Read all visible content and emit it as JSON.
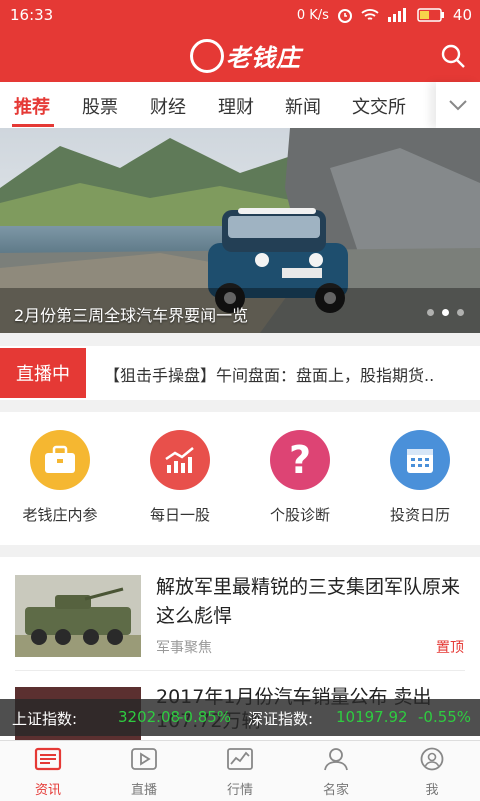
{
  "status": {
    "time": "16:33",
    "net_speed": "0 K/s",
    "battery": "40"
  },
  "header": {
    "brand": "老钱庄",
    "search_icon": "search-icon"
  },
  "tabs": [
    {
      "label": "推荐",
      "active": true
    },
    {
      "label": "股票"
    },
    {
      "label": "财经"
    },
    {
      "label": "理财"
    },
    {
      "label": "新闻"
    },
    {
      "label": "文交所"
    }
  ],
  "banner": {
    "caption": "2月份第三周全球汽车界要闻一览",
    "slide_index": 2,
    "slide_count": 3
  },
  "live": {
    "badge": "直播中",
    "text": "【狙击手操盘】午间盘面：盘面上，股指期货.."
  },
  "grid": [
    {
      "label": "老钱庄内参",
      "icon": "briefcase-icon",
      "color": "#f5b731"
    },
    {
      "label": "每日一股",
      "icon": "trend-chart-icon",
      "color": "#e8504b"
    },
    {
      "label": "个股诊断",
      "icon": "question-icon",
      "color": "#dd4474"
    },
    {
      "label": "投资日历",
      "icon": "calendar-icon",
      "color": "#4a90d9"
    }
  ],
  "news": [
    {
      "title": "解放军里最精锐的三支集团军队原来这么彪悍",
      "tag": "军事聚焦",
      "pin": "置顶"
    },
    {
      "title": "2017年1月份汽车销量公布 卖出107.72万辆"
    }
  ],
  "ticker": {
    "sh_label": "上证指数:",
    "sh_value": "3202.08",
    "sh_change": "-0.85%",
    "sz_label": "深证指数:",
    "sz_value": "10197.92",
    "sz_change": "-0.55%",
    "value_color": "#2ecc40"
  },
  "tabbar": [
    {
      "label": "资讯",
      "icon": "news-icon",
      "active": true
    },
    {
      "label": "直播",
      "icon": "play-icon"
    },
    {
      "label": "行情",
      "icon": "market-chart-icon"
    },
    {
      "label": "名家",
      "icon": "expert-icon"
    },
    {
      "label": "我",
      "icon": "user-icon"
    }
  ],
  "colors": {
    "brand_red": "#e53935"
  }
}
